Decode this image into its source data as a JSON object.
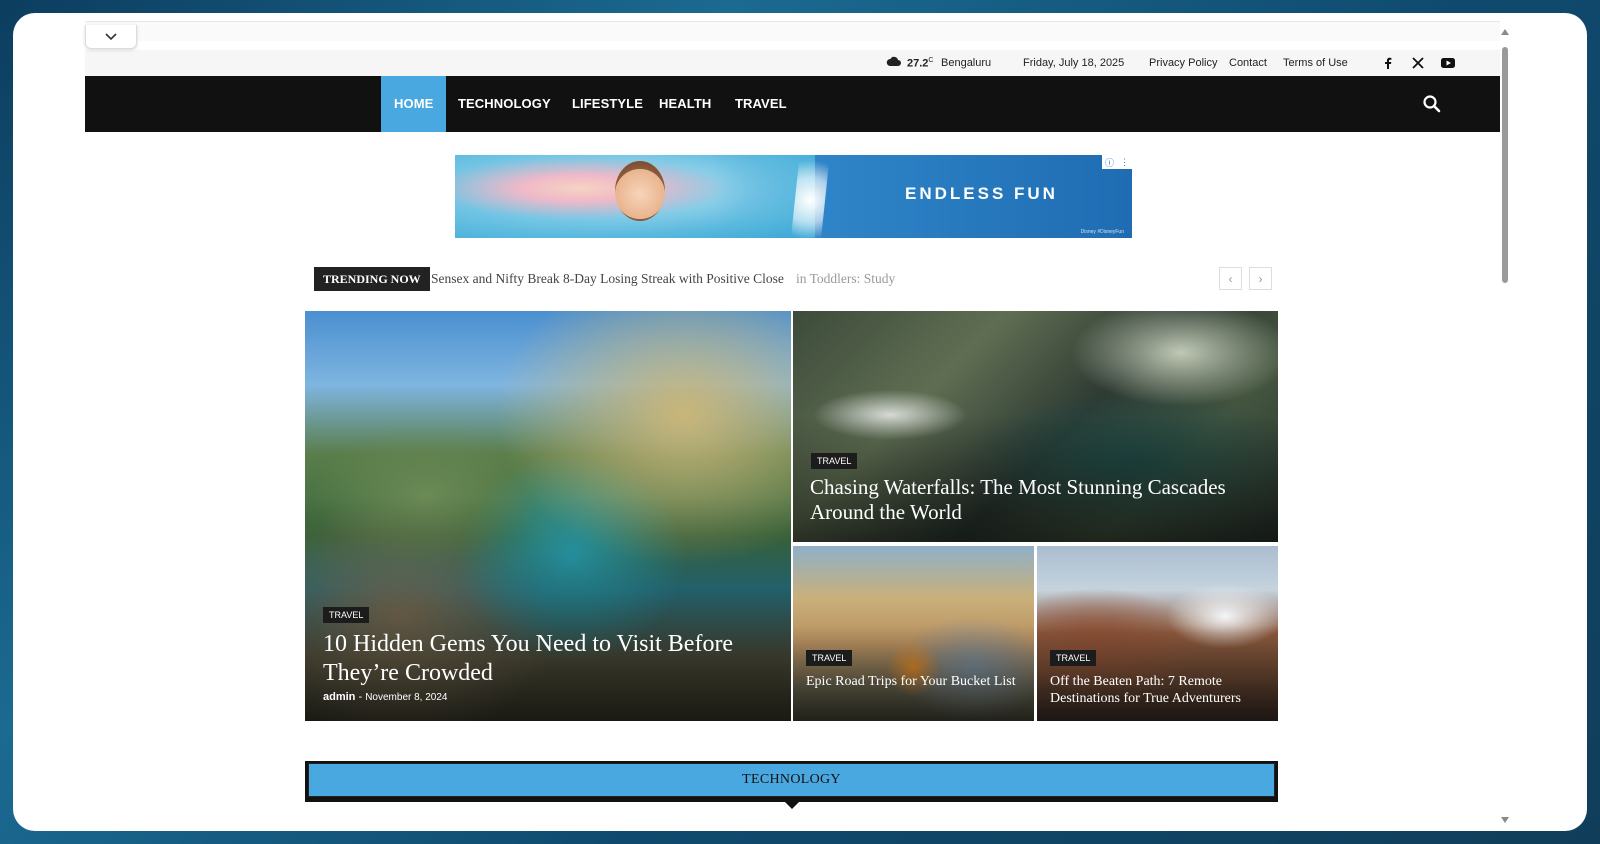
{
  "topbar": {
    "temperature": "27.2",
    "temp_unit": "C",
    "city": "Bengaluru",
    "date": "Friday, July 18, 2025",
    "links": [
      "Privacy Policy",
      "Contact",
      "Terms of Use"
    ],
    "social_icons": [
      "facebook-icon",
      "x-icon",
      "youtube-icon"
    ]
  },
  "nav": {
    "items": [
      "HOME",
      "TECHNOLOGY",
      "LIFESTYLE",
      "HEALTH",
      "TRAVEL"
    ],
    "active": "HOME"
  },
  "ad": {
    "headline": "ENDLESS FUN",
    "brand": "Disney #DisneyFun"
  },
  "trending": {
    "label": "TRENDING NOW",
    "headline": "Sensex and Nifty Break 8-Day Losing Streak with Positive Close",
    "ghost_headline": "in Toddlers: Study",
    "prev_symbol": "‹",
    "next_symbol": "›"
  },
  "featured": [
    {
      "category": "TRAVEL",
      "title": "10 Hidden Gems You Need to Visit Before They’re Crowded",
      "author": "admin",
      "separator": "-",
      "date": "November 8, 2024"
    },
    {
      "category": "TRAVEL",
      "title": "Chasing Waterfalls: The Most Stunning Cascades Around the World"
    },
    {
      "category": "TRAVEL",
      "title": "Epic Road Trips for Your Bucket List"
    },
    {
      "category": "TRAVEL",
      "title": "Off the Beaten Path: 7 Remote Destinations for True Adventurers"
    }
  ],
  "section": {
    "title": "TECHNOLOGY"
  },
  "colors": {
    "accent": "#4aa8e0",
    "nav_bg": "#111111",
    "frame_bg": "#0f4a6e"
  }
}
